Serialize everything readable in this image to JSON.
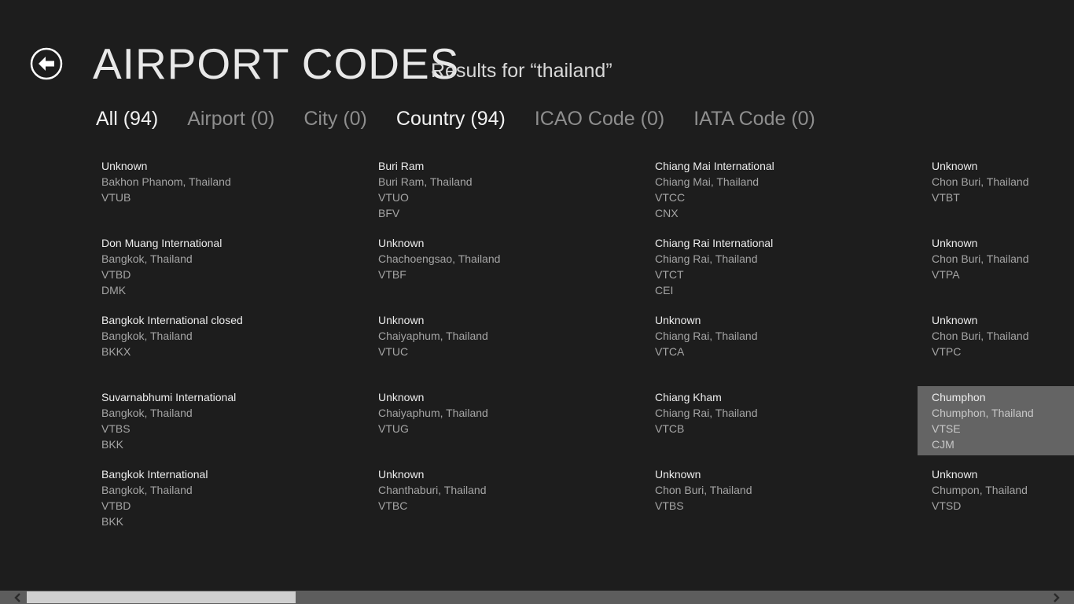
{
  "header": {
    "title": "AIRPORT CODES",
    "results_label": "Results for “thailand”",
    "back_icon": "back-arrow-circle-icon"
  },
  "filters": [
    {
      "label": "All (94)",
      "active": true
    },
    {
      "label": "Airport (0)",
      "active": false
    },
    {
      "label": "City (0)",
      "active": false
    },
    {
      "label": "Country (94)",
      "active": true
    },
    {
      "label": "ICAO Code (0)",
      "active": false
    },
    {
      "label": "IATA Code (0)",
      "active": false
    }
  ],
  "results": [
    [
      {
        "name": "Unknown",
        "location": "Bakhon Phanom, Thailand",
        "icao": "VTUB",
        "iata": ""
      },
      {
        "name": "Don Muang International",
        "location": "Bangkok, Thailand",
        "icao": "VTBD",
        "iata": "DMK"
      },
      {
        "name": "Bangkok International closed",
        "location": "Bangkok, Thailand",
        "icao": "BKKX",
        "iata": ""
      },
      {
        "name": "Suvarnabhumi International",
        "location": "Bangkok, Thailand",
        "icao": "VTBS",
        "iata": "BKK"
      },
      {
        "name": "Bangkok International",
        "location": "Bangkok, Thailand",
        "icao": "VTBD",
        "iata": "BKK"
      }
    ],
    [
      {
        "name": "Buri Ram",
        "location": "Buri Ram, Thailand",
        "icao": "VTUO",
        "iata": "BFV"
      },
      {
        "name": "Unknown",
        "location": "Chachoengsao, Thailand",
        "icao": "VTBF",
        "iata": ""
      },
      {
        "name": "Unknown",
        "location": "Chaiyaphum, Thailand",
        "icao": "VTUC",
        "iata": ""
      },
      {
        "name": "Unknown",
        "location": "Chaiyaphum, Thailand",
        "icao": "VTUG",
        "iata": ""
      },
      {
        "name": "Unknown",
        "location": "Chanthaburi, Thailand",
        "icao": "VTBC",
        "iata": ""
      }
    ],
    [
      {
        "name": "Chiang Mai International",
        "location": "Chiang Mai, Thailand",
        "icao": "VTCC",
        "iata": "CNX"
      },
      {
        "name": "Chiang Rai International",
        "location": "Chiang Rai, Thailand",
        "icao": "VTCT",
        "iata": "CEI"
      },
      {
        "name": "Unknown",
        "location": "Chiang Rai, Thailand",
        "icao": "VTCA",
        "iata": ""
      },
      {
        "name": "Chiang Kham",
        "location": "Chiang Rai, Thailand",
        "icao": "VTCB",
        "iata": ""
      },
      {
        "name": "Unknown",
        "location": "Chon Buri, Thailand",
        "icao": "VTBS",
        "iata": ""
      }
    ],
    [
      {
        "name": "Unknown",
        "location": "Chon Buri, Thailand",
        "icao": "VTBT",
        "iata": ""
      },
      {
        "name": "Unknown",
        "location": "Chon Buri, Thailand",
        "icao": "VTPA",
        "iata": ""
      },
      {
        "name": "Unknown",
        "location": "Chon Buri, Thailand",
        "icao": "VTPC",
        "iata": ""
      },
      {
        "name": "Chumphon",
        "location": "Chumphon, Thailand",
        "icao": "VTSE",
        "iata": "CJM",
        "hovered": true
      },
      {
        "name": "Unknown",
        "location": "Chumpon, Thailand",
        "icao": "VTSD",
        "iata": ""
      }
    ]
  ],
  "scrollbar": {
    "left_icon": "chevron-left-icon",
    "right_icon": "chevron-right-icon",
    "thumb_start_fraction": 0.025,
    "thumb_size_fraction": 0.25
  },
  "colors": {
    "background": "#1d1d1d",
    "hover_tile": "#646464",
    "scroll_track": "#5d5d5d",
    "scroll_thumb": "#cfcfcf",
    "primary_text": "#ececec",
    "secondary_text": "#a5a5a5"
  }
}
